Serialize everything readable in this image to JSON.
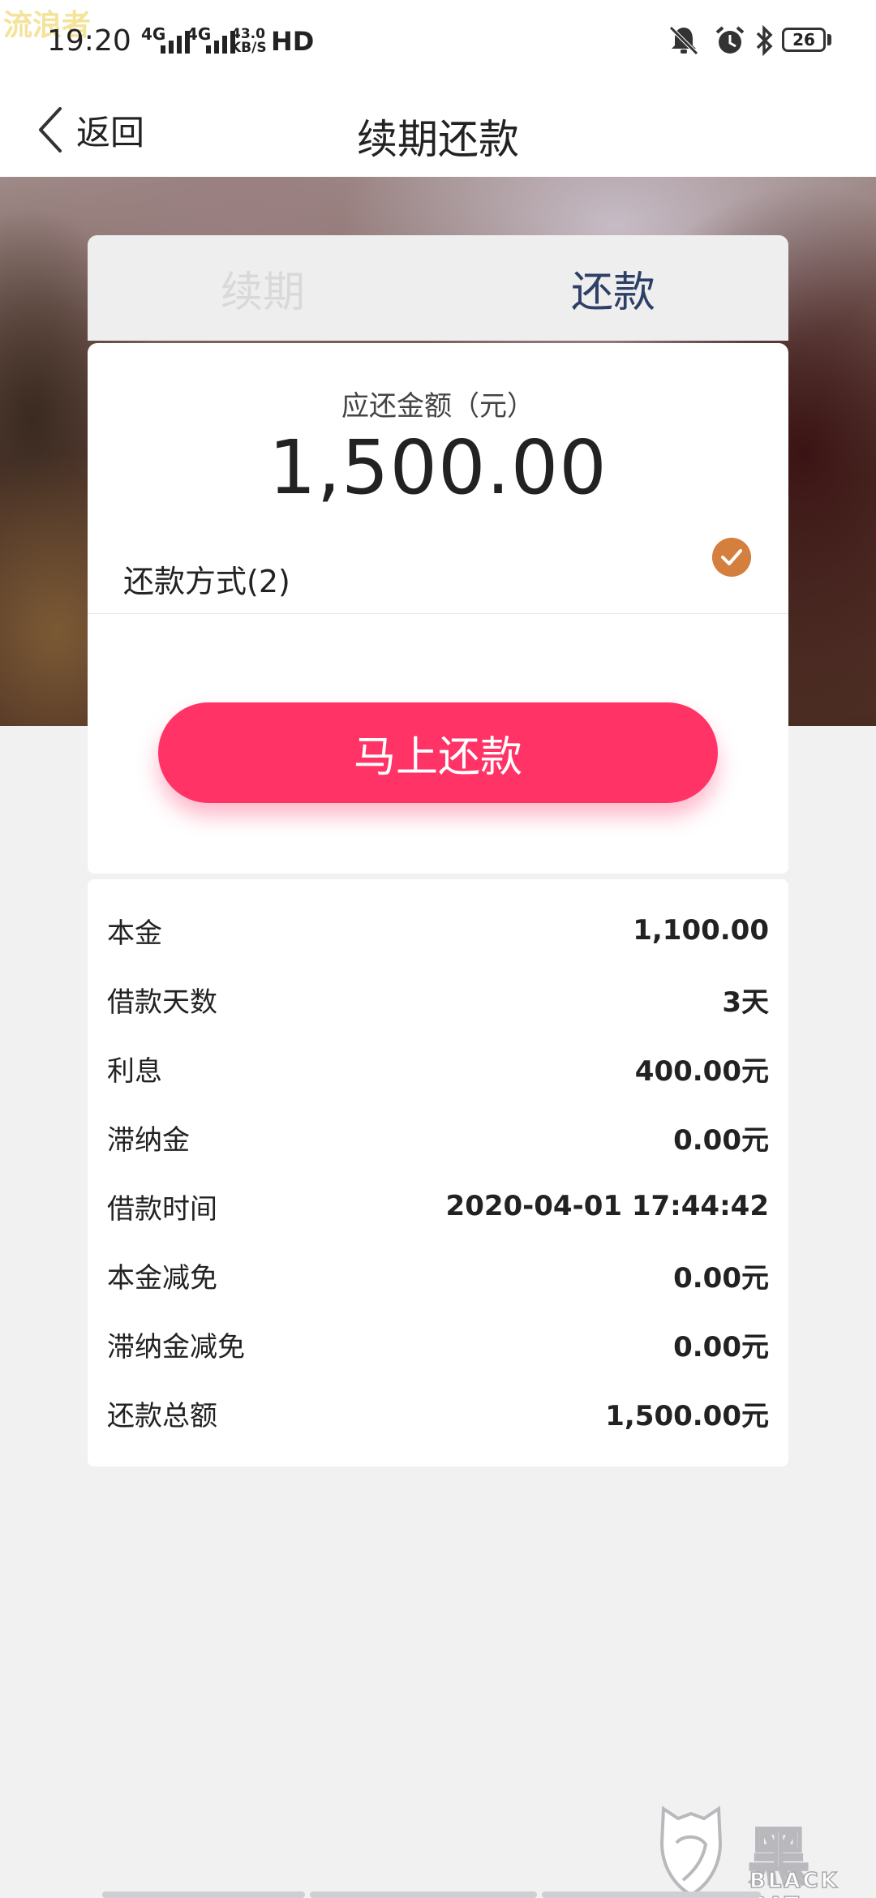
{
  "status_bar": {
    "watermark": "流浪者",
    "time": "19:20",
    "network_1": "4G",
    "network_2": "4G",
    "speed_value": "43.0",
    "speed_unit": "KB/S",
    "hd": "HD",
    "battery": "26",
    "icons": [
      "bell-muted-icon",
      "alarm-icon",
      "bluetooth-icon"
    ]
  },
  "header": {
    "back_label": "返回",
    "title": "续期还款"
  },
  "tabs": [
    {
      "label": "续期",
      "active": false
    },
    {
      "label": "还款",
      "active": true
    }
  ],
  "repayment": {
    "amount_label": "应还金额（元）",
    "amount_value": "1,500.00",
    "method_label": "还款方式(2)",
    "method_selected": true,
    "pay_button_label": "马上还款"
  },
  "details": [
    {
      "label": "本金",
      "value": "1,100.00"
    },
    {
      "label": "借款天数",
      "value": "3天"
    },
    {
      "label": "利息",
      "value": "400.00元"
    },
    {
      "label": "滞纳金",
      "value": "0.00元"
    },
    {
      "label": "借款时间",
      "value": "2020-04-01 17:44:42"
    },
    {
      "label": "本金减免",
      "value": "0.00元"
    },
    {
      "label": "滞纳金减免",
      "value": "0.00元"
    },
    {
      "label": "还款总额",
      "value": "1,500.00元"
    }
  ],
  "brand_watermark": {
    "cn": "黑猫",
    "en": "BLACK CAT"
  },
  "colors": {
    "accent_button": "#ff3366",
    "active_tab": "#2d3f66",
    "check": "#d47f3d",
    "background": "#f1f1f2"
  }
}
